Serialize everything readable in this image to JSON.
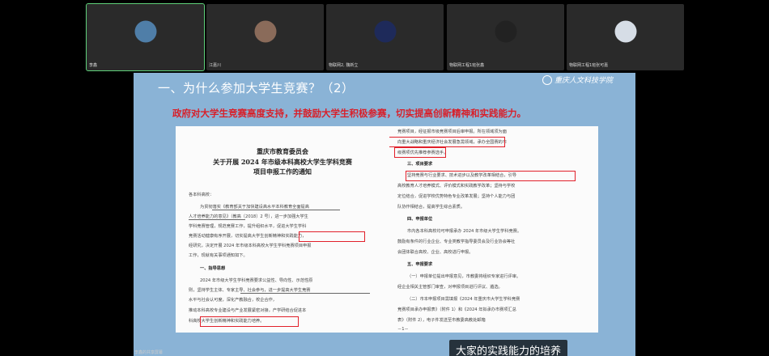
{
  "participants": [
    {
      "name": "李鑫",
      "active": true,
      "avatar_color": "#4f7ea8"
    },
    {
      "name": "江嘉川",
      "active": false,
      "avatar_color": "#8a6b5a"
    },
    {
      "name": "物联网2, 魏新立",
      "active": false,
      "avatar_color": "#1e2a5a"
    },
    {
      "name": "物联网工程1班张鑫",
      "active": false,
      "avatar_color": "#222222"
    },
    {
      "name": "物联网工程1班张可嘉",
      "active": false,
      "avatar_color": "#d6dde6"
    }
  ],
  "slide": {
    "title": "一、为什么参加大学生竞赛？（2）",
    "logo_text": "重庆人文科技学院",
    "subtitle": "政府对大学生竞赛高度支持，并鼓励大学生积极参赛，切实提高创新精神和实践能力。"
  },
  "doc": {
    "title_1": "重庆市教育委员会",
    "title_2": "关于开展 2024 年市级本科高校大学生学科竞赛",
    "title_3": "项目申报工作的通知",
    "left_lines": [
      "各本科高校：",
      "为贯彻落实《教育部关于加快建设高水平本科教育全面提高",
      "人才培养能力的意见》（教高〔2018〕2 号），进一步加强大学生",
      "学科竞赛管理，规范竞赛工作，提升组织水平，促进大学生学科",
      "竞赛活动健康有序开展，切实提高大学生创新精神和实践能力，",
      "经研究，决定开展 2024 年市级本科高校大学生学科竞赛项目申报",
      "工作，现就有关事项通知如下。",
      "一、指导思想",
      "2024 年市级大学生学科竞赛要求公益性、导向性、示范性原",
      "则，坚持学生主体、专家主导、社会参与，进一步提高大学生竞赛",
      "水平与社会认可度，深化产教融合，校企合作，",
      "推动本科高校专业建设与产业发展紧密对接，产学研结合促进本",
      "科高校大学生创新精神和实践能力培养。"
    ],
    "right_lines": [
      "竞赛项目，经征报市级竞赛项目后审申报。所在领域须为面",
      "向重大战略和重庆经济社会发展急需领域，承办全国赛的市",
      "级赛项优先推荐参赛选手。",
      "三、项目要求",
      "坚持竞赛与行业要求、技术进步以及教学改革相结合，引导",
      "高校教育人才培养模式、评价模式和实践教学改革；坚持与学校",
      "定位结合，促进学校优势特色专业改革发展；坚持个人能力与团",
      "队协作相结合，提高学生综合素质。",
      "四、申报单位",
      "市内各本科高校均可申报承办 2024 年市级大学生学科竞赛。",
      "鼓励有条件的行业企业、专业类教学指导委员会及行业协会等社",
      "会团体联合高校、企业、高校进行申报。",
      "五、申报要求",
      "（一）申报单位提出申报意见，市教委将组织专家进行评审。",
      "经企业相关主管部门审查，对申报项目进行评议、遴选。",
      "（二）市本申报项目需填报《2024 年重庆市大学生学科竞赛",
      "竞赛项目承办申报表》（附件 1）和《2024 年拟承办市赛项汇总",
      "表》（附件 2），电子件发送至市教委高教处邮箱",
      "－1－"
    ]
  },
  "live_subtitle": "大家的实践能力的培养",
  "speaker_label": "李鑫的共享屏幕"
}
